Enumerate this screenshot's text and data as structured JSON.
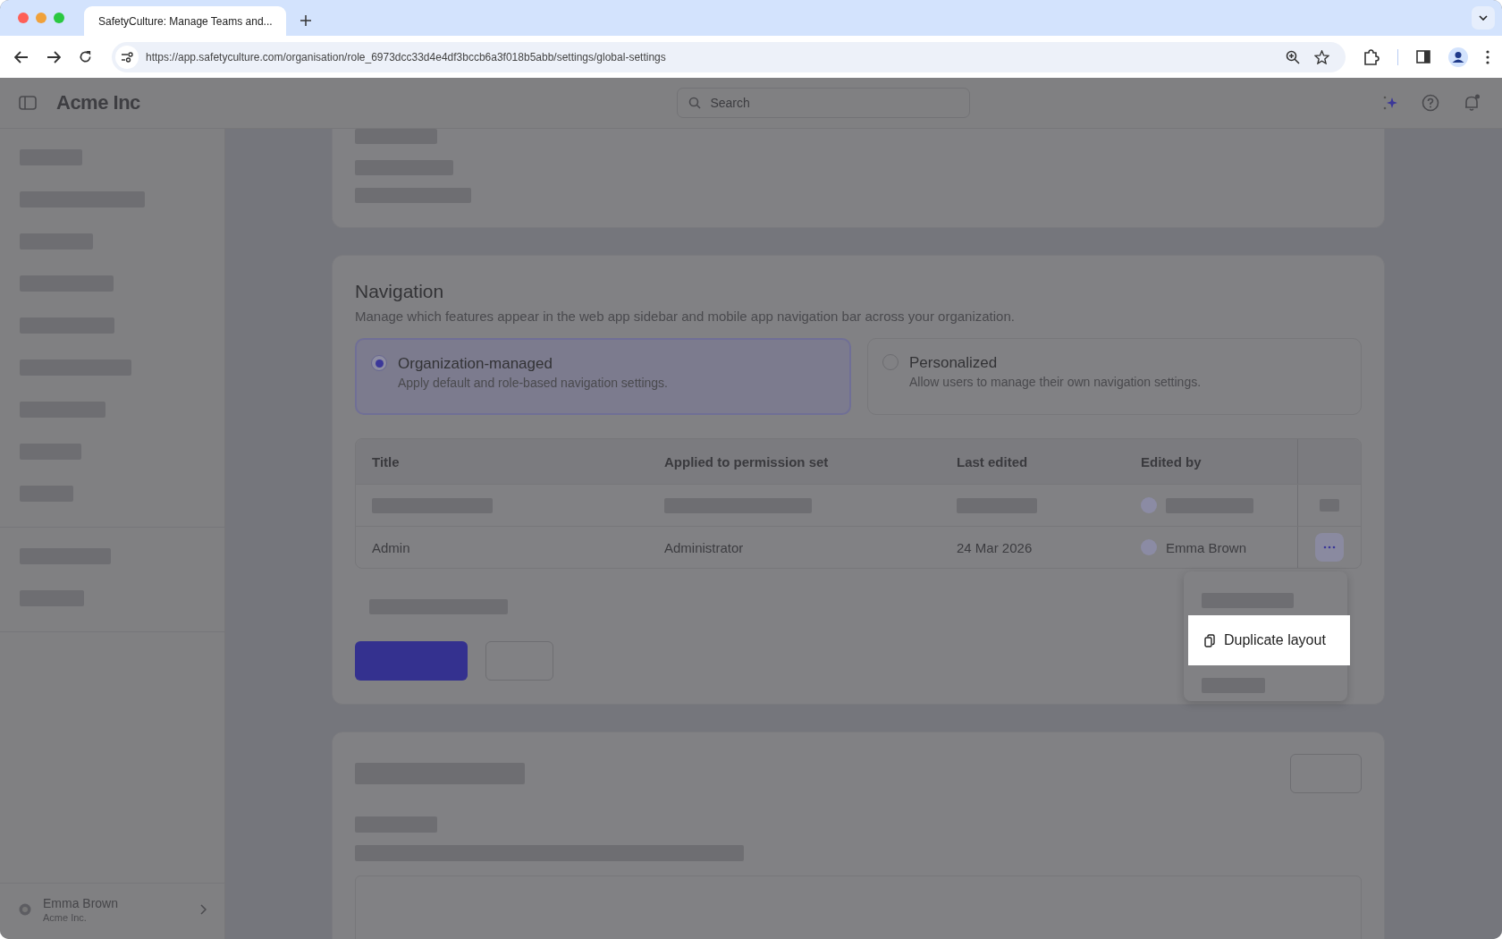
{
  "browser": {
    "tab_title": "SafetyCulture: Manage Teams and...",
    "url": "https://app.safetyculture.com/organisation/role_6973dcc33d4e4df3bccb6a3f018b5abb/settings/global-settings"
  },
  "header": {
    "org_name": "Acme Inc",
    "search": {
      "placeholder": "Search"
    }
  },
  "sidebar": {
    "user": {
      "name": "Emma Brown",
      "org": "Acme Inc."
    }
  },
  "navigation": {
    "title": "Navigation",
    "description": "Manage which features appear in the web app sidebar and mobile app navigation bar across your organization.",
    "options": [
      {
        "title": "Organization-managed",
        "description": "Apply default and role-based navigation settings.",
        "selected": true
      },
      {
        "title": "Personalized",
        "description": "Allow users to manage their own navigation settings.",
        "selected": false
      }
    ],
    "table": {
      "columns": [
        "Title",
        "Applied to permission set",
        "Last edited",
        "Edited by"
      ],
      "rows": [
        {
          "title": "Admin",
          "permission_set": "Administrator",
          "last_edited": "24 Mar 2026",
          "edited_by": "Emma Brown"
        }
      ]
    }
  },
  "menu": {
    "items": [
      "Duplicate layout"
    ]
  }
}
